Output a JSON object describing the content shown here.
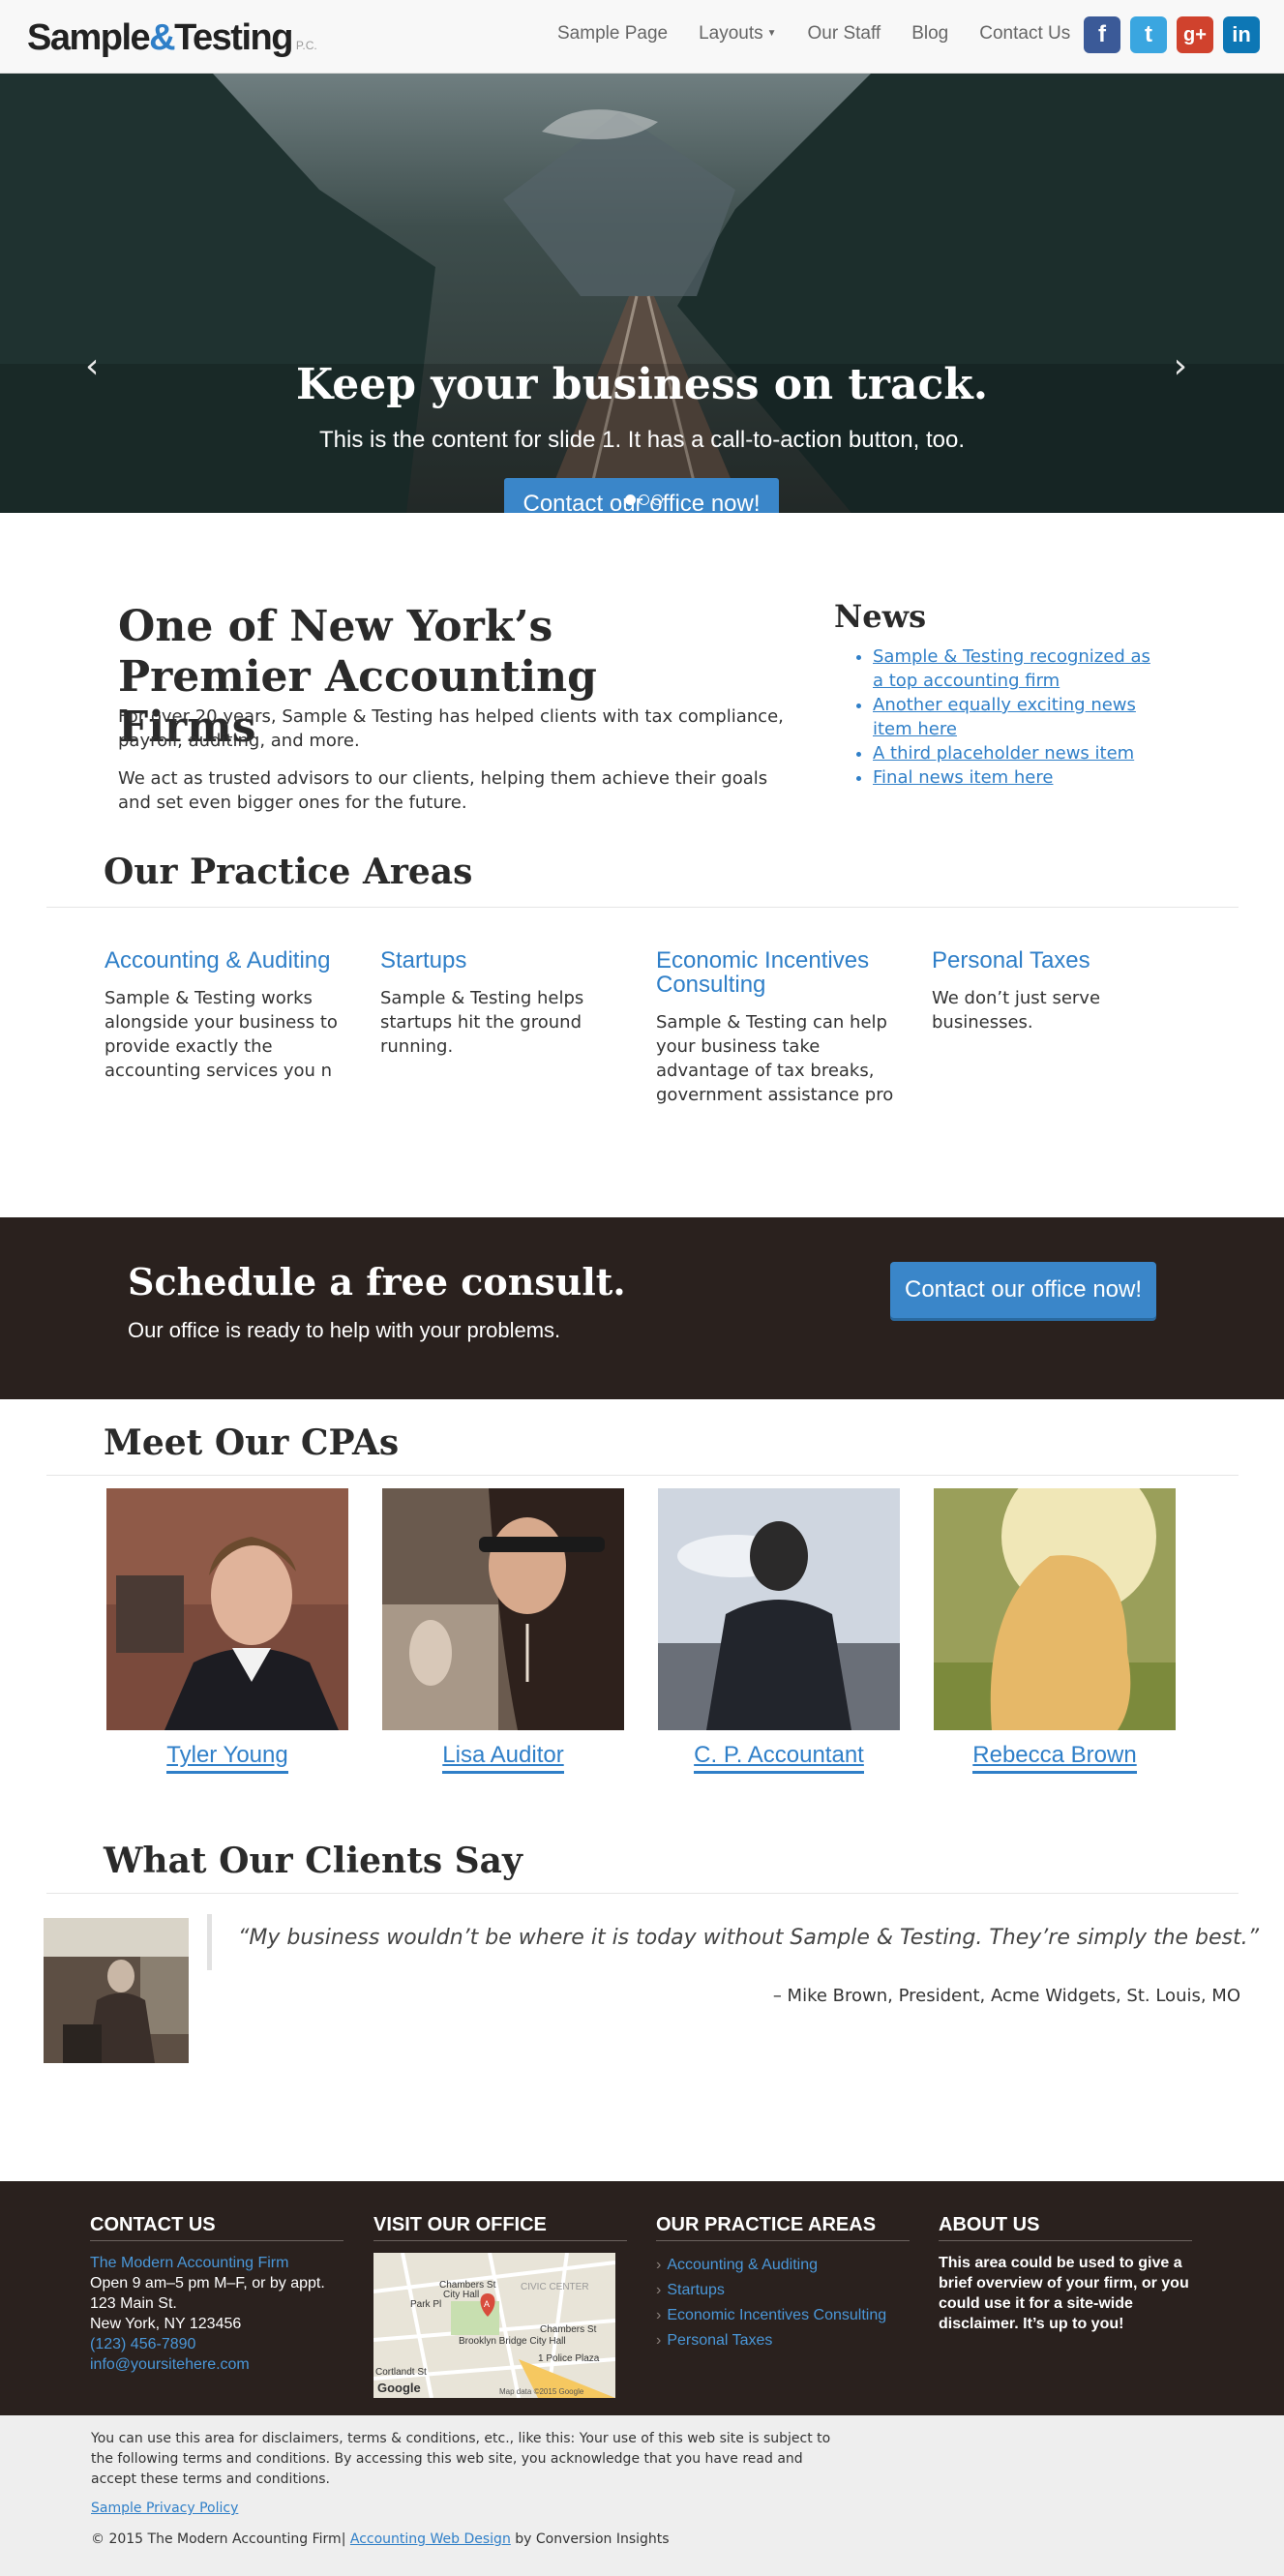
{
  "header": {
    "logo_main": "Sample",
    "logo_amp": "&",
    "logo_second": "Testing",
    "logo_suffix": "P.C.",
    "nav": [
      "Sample Page",
      "Layouts",
      "Our Staff",
      "Blog",
      "Contact Us"
    ],
    "social": [
      {
        "icon": "facebook-icon",
        "glyph": "f"
      },
      {
        "icon": "twitter-icon",
        "glyph": "t"
      },
      {
        "icon": "google-plus-icon",
        "glyph": "g+"
      },
      {
        "icon": "linkedin-icon",
        "glyph": "in"
      }
    ]
  },
  "hero": {
    "title": "Keep your business on track.",
    "subtitle": "This is the content for slide 1. It has a call-to-action button, too.",
    "cta": "Contact our office now!",
    "prev_glyph": "‹",
    "next_glyph": "›",
    "active_slide": 1,
    "slide_count": 3
  },
  "intro": {
    "title": "One of New York’s Premier Accounting Firms",
    "p1": "For over 20 years, Sample & Testing has helped clients with tax compliance, payroll, auditing, and more.",
    "p2": "We act as trusted advisors to our clients, helping them achieve their goals and set even bigger ones for the future."
  },
  "news": {
    "title": "News",
    "items": [
      "Sample & Testing recognized as a top accounting firm",
      "Another equally exciting news item here",
      "A third placeholder news item",
      "Final news item here"
    ]
  },
  "practice": {
    "title": "Our Practice Areas",
    "areas": [
      {
        "title": "Accounting & Auditing",
        "text": "Sample & Testing works alongside your business to provide exactly the accounting services you n"
      },
      {
        "title": "Startups",
        "text": "Sample & Testing helps startups hit the ground running."
      },
      {
        "title": "Economic Incentives Consulting",
        "text": "Sample & Testing can help your business take advantage of tax breaks, government assistance pro"
      },
      {
        "title": "Personal Taxes",
        "text": "We don’t just serve businesses."
      }
    ]
  },
  "consult": {
    "title": "Schedule a free consult.",
    "subtitle": "Our office is ready to help with your problems.",
    "button": "Contact our office now!"
  },
  "cpas": {
    "title": "Meet Our CPAs",
    "people": [
      "Tyler Young",
      "Lisa Auditor",
      "C. P. Accountant",
      "Rebecca Brown"
    ]
  },
  "clients": {
    "title": "What Our Clients Say",
    "quote": "“My business wouldn’t be where it is today without Sample & Testing. They’re simply the best.”",
    "cite": "– Mike Brown, President, Acme Widgets, St. Louis, MO"
  },
  "footer": {
    "contact": {
      "title": "CONTACT US",
      "firm": "The Modern Accounting Firm",
      "hours": "Open 9 am–5 pm M–F, or by appt.",
      "street": "123 Main St.",
      "city": "New York, NY 123456",
      "phone": "(123) 456-7890",
      "email": "info@yoursitehere.com"
    },
    "visit": {
      "title": "VISIT OUR OFFICE",
      "map_labels": [
        "Chambers St",
        "City Hall",
        "CIVIC CENTER",
        "Park Pl",
        "Brooklyn Bridge City Hall",
        "1 Police Plaza",
        "Chambers St",
        "Cortlandt St",
        "Map data ©2015 Google",
        "Google"
      ],
      "marker": "A"
    },
    "areas": {
      "title": "OUR PRACTICE AREAS",
      "items": [
        "Accounting & Auditing",
        "Startups",
        "Economic Incentives Consulting",
        "Personal Taxes"
      ]
    },
    "about": {
      "title": "ABOUT US",
      "text": "This area could be used to give a brief overview of your firm, or you could use it for a site-wide disclaimer. It’s up to you!"
    }
  },
  "bottom": {
    "disclaimer": "You can use this area for disclaimers, terms & conditions, etc., like this: Your use of this web site is subject to the following terms and conditions. By accessing this web site, you acknowledge that you have read and accept these terms and conditions.",
    "privacy": "Sample Privacy Policy",
    "copy_prefix": "© 2015 The Modern Accounting Firm|",
    "copy_link": "Accounting Web Design",
    "copy_suffix": "by Conversion Insights"
  },
  "colors": {
    "accent": "#2f7fc8",
    "dark_band": "#2a211e",
    "button": "#3a86c9"
  }
}
